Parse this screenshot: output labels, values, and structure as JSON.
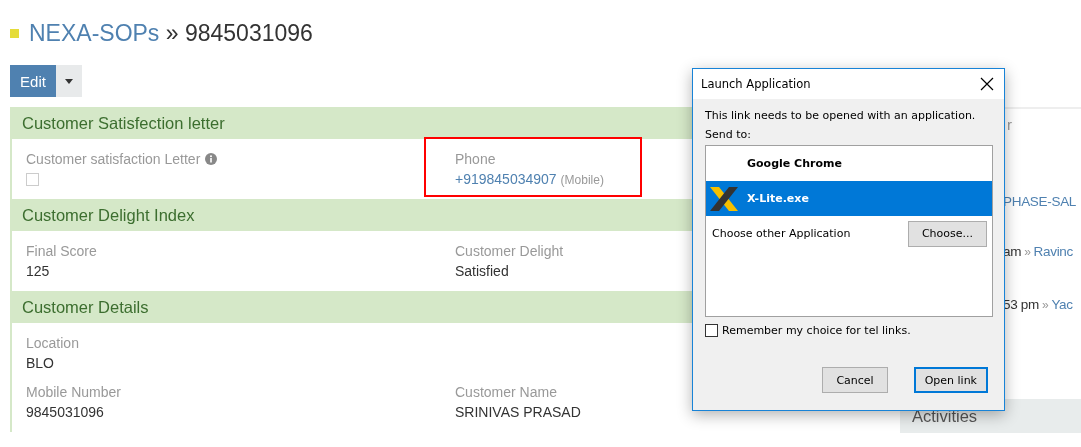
{
  "breadcrumb": {
    "parent": "NEXA-SOPs",
    "separator": "»",
    "current": "9845031096"
  },
  "toolbar": {
    "edit_button": "Edit"
  },
  "sections": [
    {
      "title": "Customer Satisfection letter",
      "rows": [
        [
          {
            "kind": "checkbox",
            "label": "Customer satisfaction Letter",
            "info": true,
            "checked": false
          },
          {
            "kind": "phone",
            "label": "Phone",
            "value": "+919845034907",
            "note": "(Mobile)",
            "highlighted": true
          }
        ]
      ]
    },
    {
      "title": "Customer Delight Index",
      "rows": [
        [
          {
            "kind": "text",
            "label": "Final Score",
            "value": "125"
          },
          {
            "kind": "text",
            "label": "Customer Delight",
            "value": "Satisfied"
          }
        ]
      ]
    },
    {
      "title": "Customer Details",
      "rows": [
        [
          {
            "kind": "text",
            "label": "Location",
            "value": "BLO"
          }
        ],
        [
          {
            "kind": "text",
            "label": "Mobile Number",
            "value": "9845031096"
          },
          {
            "kind": "text",
            "label": "Customer Name",
            "value": "SRINIVAS PRASAD"
          }
        ]
      ]
    }
  ],
  "sidebar": {
    "items": [
      {
        "kind": "heading",
        "text": "r"
      },
      {
        "kind": "link",
        "text": "PHASE-SAL"
      },
      {
        "kind": "activity",
        "time": "am",
        "separator": "»",
        "link": "Ravinc"
      },
      {
        "kind": "activity",
        "time": "53 pm",
        "separator": "»",
        "link": "Yac"
      }
    ],
    "activities_title": "Activities"
  },
  "dialog": {
    "title": "Launch Application",
    "message": "This link needs to be opened with an application.",
    "send_to": "Send to:",
    "apps": [
      {
        "name": "Google Chrome",
        "kind": "plain",
        "selected": false
      },
      {
        "name": "X-Lite.exe",
        "kind": "logo",
        "selected": true
      }
    ],
    "choose_other": "Choose other Application",
    "choose_button": "Choose...",
    "remember": {
      "label": "Remember my choice for tel links.",
      "checked": false
    },
    "buttons": [
      {
        "label": "Cancel",
        "default": false
      },
      {
        "label": "Open link",
        "default": true
      }
    ]
  }
}
